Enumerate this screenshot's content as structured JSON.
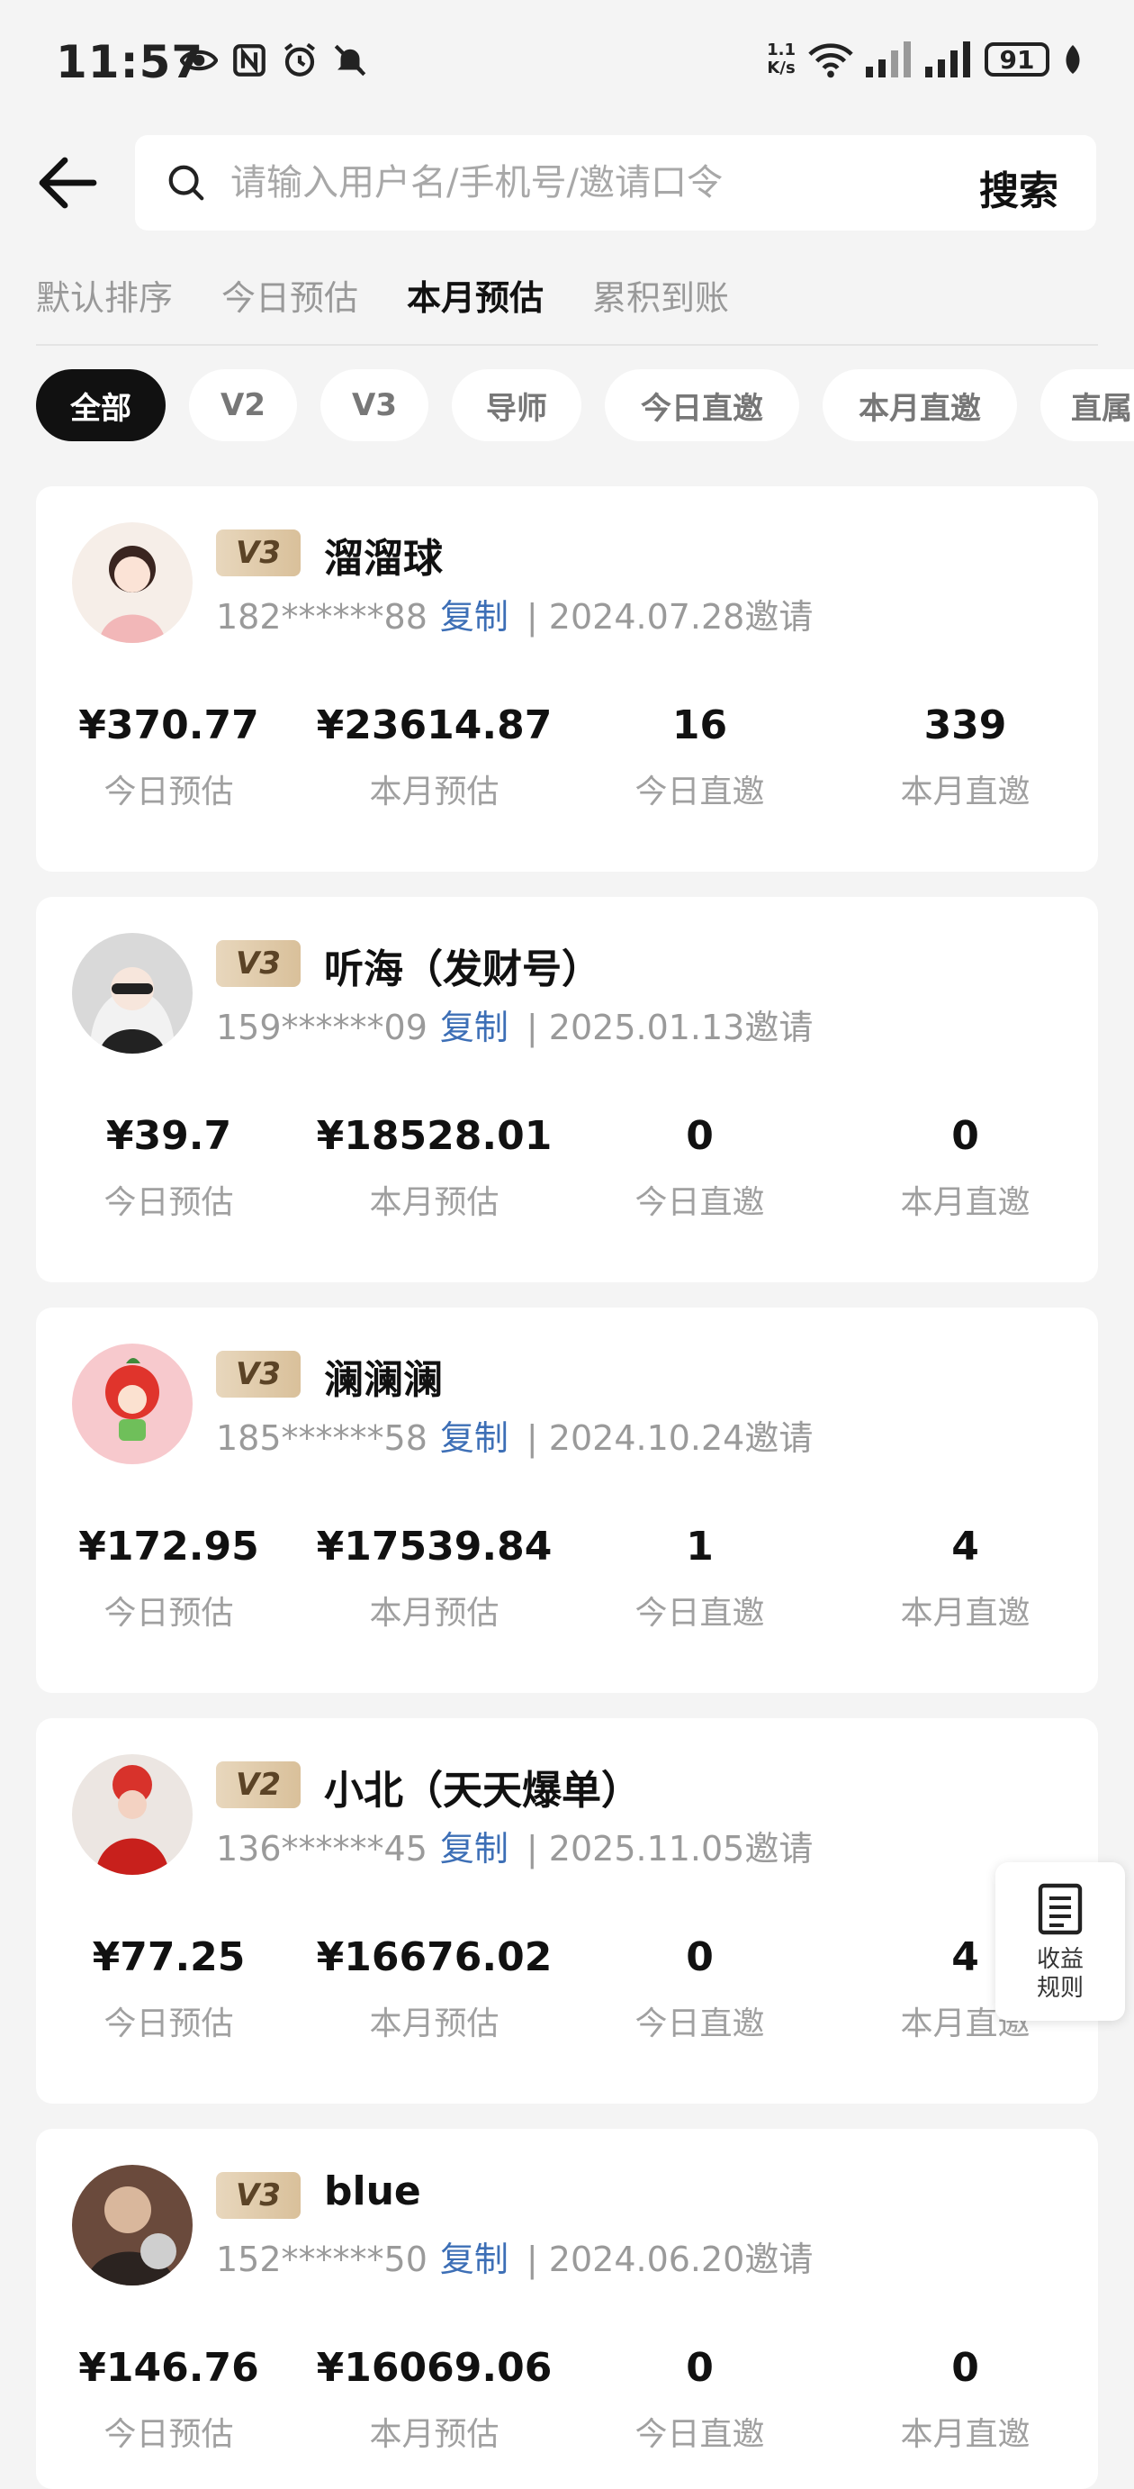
{
  "status_bar": {
    "time": "11:57",
    "net_speed_value": "1.1",
    "net_speed_unit": "K/s",
    "battery": "91"
  },
  "search": {
    "placeholder": "请输入用户名/手机号/邀请口令",
    "button_label": "搜索"
  },
  "sort_tabs": [
    {
      "label": "默认排序",
      "active": false
    },
    {
      "label": "今日预估",
      "active": false
    },
    {
      "label": "本月预估",
      "active": true
    },
    {
      "label": "累积到账",
      "active": false
    }
  ],
  "filter_chips": [
    {
      "label": "全部",
      "active": true
    },
    {
      "label": "V2",
      "active": false
    },
    {
      "label": "V3",
      "active": false
    },
    {
      "label": "导师",
      "active": false
    },
    {
      "label": "今日直邀",
      "active": false
    },
    {
      "label": "本月直邀",
      "active": false
    },
    {
      "label": "直属",
      "active": false
    }
  ],
  "stat_labels": [
    "今日预估",
    "本月预估",
    "今日直邀",
    "本月直邀"
  ],
  "copy_label": "复制",
  "members": [
    {
      "level": "V3",
      "name": "溜溜球",
      "phone": "182******88",
      "invite": "| 2024.07.28邀请",
      "stats": [
        "¥370.77",
        "¥23614.87",
        "16",
        "339"
      ]
    },
    {
      "level": "V3",
      "name": "听海（发财号）",
      "phone": "159******09",
      "invite": "| 2025.01.13邀请",
      "stats": [
        "¥39.7",
        "¥18528.01",
        "0",
        "0"
      ]
    },
    {
      "level": "V3",
      "name": "澜澜澜",
      "phone": "185******58",
      "invite": "| 2024.10.24邀请",
      "stats": [
        "¥172.95",
        "¥17539.84",
        "1",
        "4"
      ]
    },
    {
      "level": "V2",
      "name": "小北（天天爆单）",
      "phone": "136******45",
      "invite": "| 2025.11.05邀请",
      "stats": [
        "¥77.25",
        "¥16676.02",
        "0",
        "4"
      ]
    },
    {
      "level": "V3",
      "name": "blue",
      "phone": "152******50",
      "invite": "| 2024.06.20邀请",
      "stats": [
        "¥146.76",
        "¥16069.06",
        "0",
        "0"
      ]
    }
  ],
  "float_button": {
    "line1": "收益",
    "line2": "规则"
  },
  "icons": {
    "back": "arrow-left-icon",
    "search": "search-icon",
    "rules": "document-icon"
  }
}
